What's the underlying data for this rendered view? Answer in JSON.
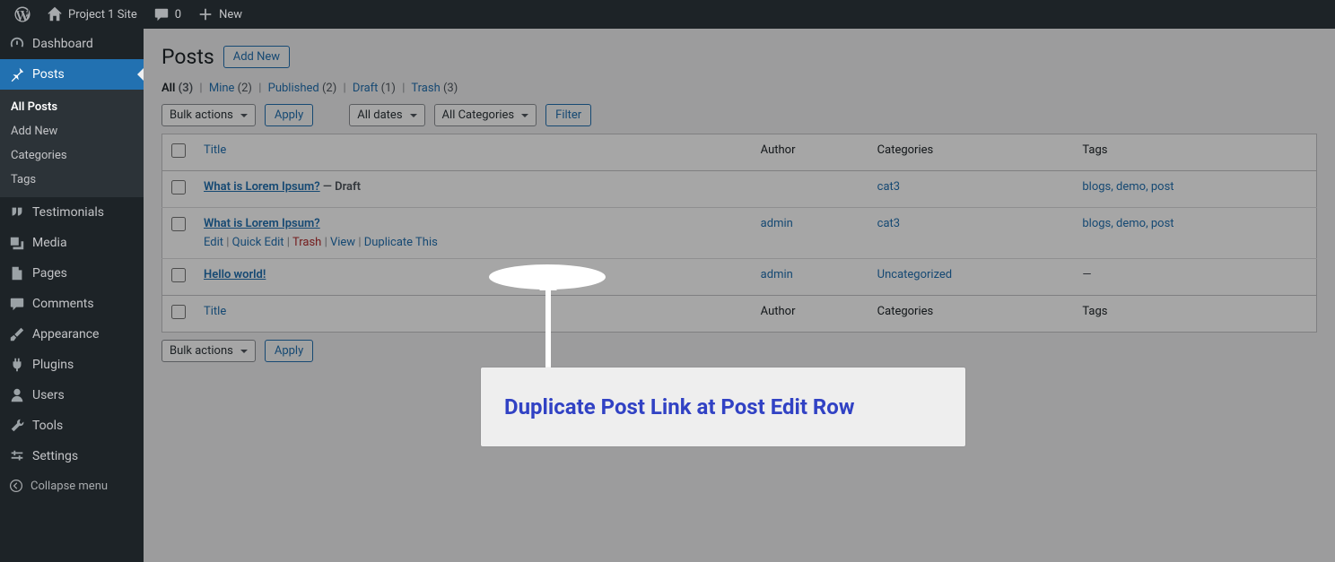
{
  "toolbar": {
    "site_name": "Project 1 Site",
    "comments_count": "0",
    "new_label": "New"
  },
  "sidebar": {
    "items": [
      {
        "label": "Dashboard"
      },
      {
        "label": "Posts"
      },
      {
        "label": "Testimonials"
      },
      {
        "label": "Media"
      },
      {
        "label": "Pages"
      },
      {
        "label": "Comments"
      },
      {
        "label": "Appearance"
      },
      {
        "label": "Plugins"
      },
      {
        "label": "Users"
      },
      {
        "label": "Tools"
      },
      {
        "label": "Settings"
      }
    ],
    "posts_submenu": [
      {
        "label": "All Posts",
        "active": true
      },
      {
        "label": "Add New"
      },
      {
        "label": "Categories"
      },
      {
        "label": "Tags"
      }
    ],
    "collapse_label": "Collapse menu"
  },
  "page": {
    "title": "Posts",
    "add_new_label": "Add New"
  },
  "filters": {
    "links": [
      {
        "label": "All",
        "count": "(3)",
        "current": true
      },
      {
        "label": "Mine",
        "count": "(2)"
      },
      {
        "label": "Published",
        "count": "(2)"
      },
      {
        "label": "Draft",
        "count": "(1)"
      },
      {
        "label": "Trash",
        "count": "(3)"
      }
    ],
    "bulk_actions_label": "Bulk actions",
    "apply_label": "Apply",
    "date_filter_label": "All dates",
    "category_filter_label": "All Categories",
    "filter_label": "Filter"
  },
  "table": {
    "columns": {
      "title": "Title",
      "author": "Author",
      "categories": "Categories",
      "tags": "Tags"
    },
    "rows": [
      {
        "title": "What is Lorem Ipsum?",
        "state": "— Draft",
        "author": "",
        "categories": "cat3",
        "tags": "blogs, demo, post",
        "show_actions": false
      },
      {
        "title": "What is Lorem Ipsum?",
        "state": "",
        "author": "admin",
        "categories": "cat3",
        "tags": "blogs, demo, post",
        "show_actions": true
      },
      {
        "title": "Hello world!",
        "state": "",
        "author": "admin",
        "categories": "Uncategorized",
        "tags": "—",
        "show_actions": false
      }
    ],
    "row_actions": {
      "edit": "Edit",
      "quick_edit": "Quick Edit",
      "trash": "Trash",
      "view": "View",
      "duplicate": "Duplicate This"
    }
  },
  "annotation": {
    "callout_text": "Duplicate Post Link at Post Edit Row"
  }
}
